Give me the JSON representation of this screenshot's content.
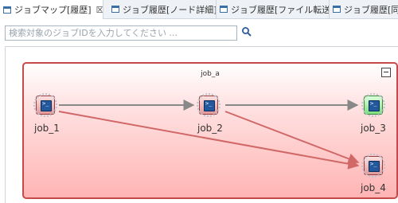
{
  "tabs": [
    {
      "label": "ジョブマップ[履歴]",
      "close": "☒",
      "active": true
    },
    {
      "label": "ジョブ履歴[ノード詳細]"
    },
    {
      "label": "ジョブ履歴[ファイル転送]"
    },
    {
      "label": "ジョブ履歴[同"
    }
  ],
  "search": {
    "placeholder": "検索対象のジョブIDを入力してください ..."
  },
  "jobnet": {
    "title": "job_a"
  },
  "jobs": [
    {
      "id": "job_1",
      "status": "error"
    },
    {
      "id": "job_2",
      "status": "error"
    },
    {
      "id": "job_3",
      "status": "success"
    },
    {
      "id": "job_4",
      "status": "error"
    }
  ],
  "colors": {
    "error": "#c64a4a",
    "success": "#3c8a3c",
    "edge_normal": "#888888",
    "edge_error": "#d06868"
  }
}
